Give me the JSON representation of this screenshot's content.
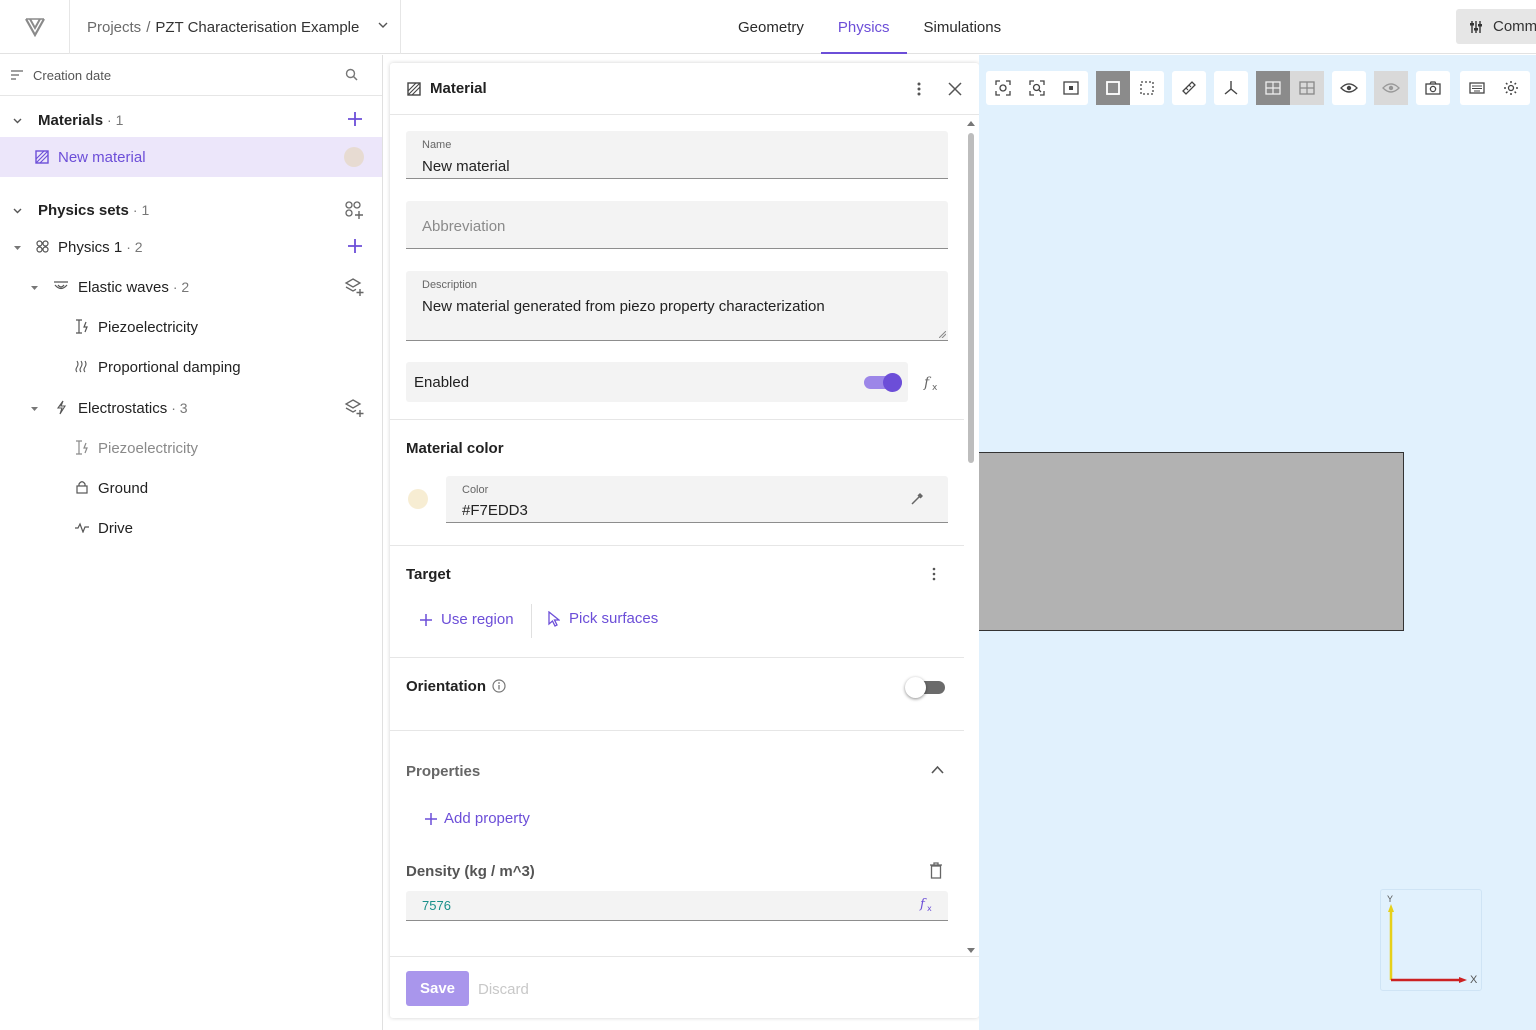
{
  "header": {
    "breadcrumb_root": "Projects",
    "breadcrumb_sep": "/",
    "project_name": "PZT Characterisation Example",
    "tabs": [
      {
        "label": "Geometry",
        "active": false
      },
      {
        "label": "Physics",
        "active": true
      },
      {
        "label": "Simulations",
        "active": false
      }
    ],
    "comm_button": "Comm"
  },
  "sidebar": {
    "sort_label": "Creation date",
    "materials": {
      "label": "Materials",
      "count": "· 1"
    },
    "material_item": {
      "label": "New material"
    },
    "physics_sets": {
      "label": "Physics sets",
      "count": "· 1"
    },
    "physics1": {
      "label": "Physics 1",
      "count": "· 2"
    },
    "elastic": {
      "label": "Elastic waves",
      "count": "· 2"
    },
    "elastic_children": [
      "Piezoelectricity",
      "Proportional damping"
    ],
    "electro": {
      "label": "Electrostatics",
      "count": "· 3"
    },
    "electro_children": [
      "Piezoelectricity",
      "Ground",
      "Drive"
    ]
  },
  "panel": {
    "title": "Material",
    "name_label": "Name",
    "name_value": "New material",
    "abbr_placeholder": "Abbreviation",
    "desc_label": "Description",
    "desc_value": "New material generated from piezo property characterization",
    "enabled_label": "Enabled",
    "enabled": true,
    "material_color_title": "Material color",
    "color_label": "Color",
    "color_value": "#F7EDD3",
    "target_title": "Target",
    "use_region": "Use region",
    "pick_surfaces": "Pick surfaces",
    "orientation_title": "Orientation",
    "orientation_enabled": false,
    "properties_title": "Properties",
    "add_property": "Add property",
    "density_label": "Density (kg / m^3)",
    "density_value": "7576",
    "save": "Save",
    "discard": "Discard"
  },
  "viewport": {
    "axis_y": "Y",
    "axis_x": "X"
  },
  "colors": {
    "accent": "#6c4ed8",
    "viewport_bg": "#e1f1fd",
    "material_swatch": "#F7EDD3",
    "density_value": "#1a8f8a"
  }
}
